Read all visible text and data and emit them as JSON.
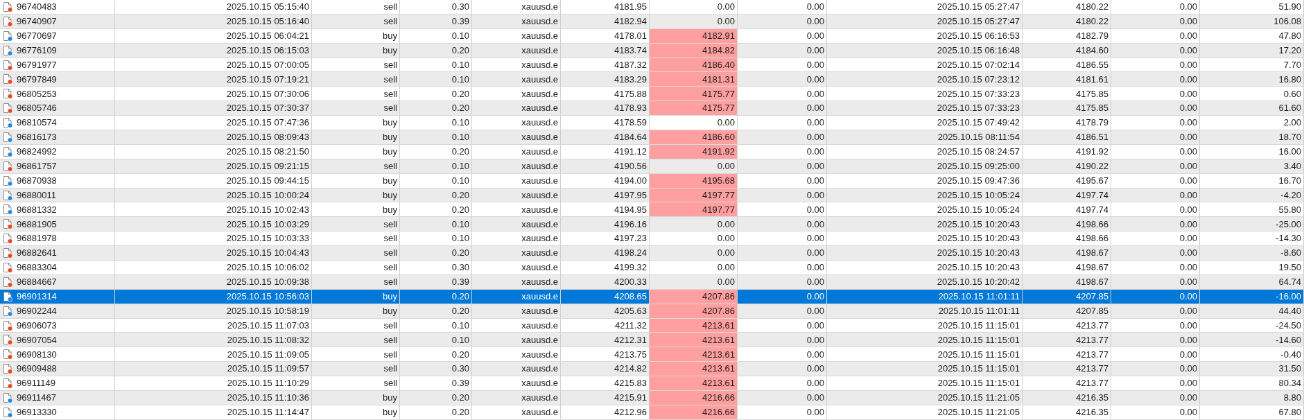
{
  "table": {
    "rows": [
      {
        "kind": "sell",
        "selected": false,
        "ticket": "96740483",
        "open_time": "2025.10.15 05:15:40",
        "type": "sell",
        "size": "0.30",
        "symbol": "xauusd.e",
        "open_price": "4181.95",
        "sl": "0.00",
        "sl_hit": false,
        "tp": "0.00",
        "close_time": "2025.10.15 05:27:47",
        "close_price": "4180.22",
        "swap": "0.00",
        "profit": "51.90"
      },
      {
        "kind": "sell",
        "selected": false,
        "ticket": "96740907",
        "open_time": "2025.10.15 05:16:40",
        "type": "sell",
        "size": "0.39",
        "symbol": "xauusd.e",
        "open_price": "4182.94",
        "sl": "0.00",
        "sl_hit": false,
        "tp": "0.00",
        "close_time": "2025.10.15 05:27:47",
        "close_price": "4180.22",
        "swap": "0.00",
        "profit": "106.08"
      },
      {
        "kind": "buy",
        "selected": false,
        "ticket": "96770697",
        "open_time": "2025.10.15 06:04:21",
        "type": "buy",
        "size": "0.10",
        "symbol": "xauusd.e",
        "open_price": "4178.01",
        "sl": "4182.91",
        "sl_hit": true,
        "tp": "0.00",
        "close_time": "2025.10.15 06:16:53",
        "close_price": "4182.79",
        "swap": "0.00",
        "profit": "47.80"
      },
      {
        "kind": "buy",
        "selected": false,
        "ticket": "96776109",
        "open_time": "2025.10.15 06:15:03",
        "type": "buy",
        "size": "0.20",
        "symbol": "xauusd.e",
        "open_price": "4183.74",
        "sl": "4184.82",
        "sl_hit": true,
        "tp": "0.00",
        "close_time": "2025.10.15 06:16:48",
        "close_price": "4184.60",
        "swap": "0.00",
        "profit": "17.20"
      },
      {
        "kind": "sell",
        "selected": false,
        "ticket": "96791977",
        "open_time": "2025.10.15 07:00:05",
        "type": "sell",
        "size": "0.10",
        "symbol": "xauusd.e",
        "open_price": "4187.32",
        "sl": "4186.40",
        "sl_hit": true,
        "tp": "0.00",
        "close_time": "2025.10.15 07:02:14",
        "close_price": "4186.55",
        "swap": "0.00",
        "profit": "7.70"
      },
      {
        "kind": "sell",
        "selected": false,
        "ticket": "96797849",
        "open_time": "2025.10.15 07:19:21",
        "type": "sell",
        "size": "0.10",
        "symbol": "xauusd.e",
        "open_price": "4183.29",
        "sl": "4181.31",
        "sl_hit": true,
        "tp": "0.00",
        "close_time": "2025.10.15 07:23:12",
        "close_price": "4181.61",
        "swap": "0.00",
        "profit": "16.80"
      },
      {
        "kind": "sell",
        "selected": false,
        "ticket": "96805253",
        "open_time": "2025.10.15 07:30:06",
        "type": "sell",
        "size": "0.20",
        "symbol": "xauusd.e",
        "open_price": "4175.88",
        "sl": "4175.77",
        "sl_hit": true,
        "tp": "0.00",
        "close_time": "2025.10.15 07:33:23",
        "close_price": "4175.85",
        "swap": "0.00",
        "profit": "0.60"
      },
      {
        "kind": "sell",
        "selected": false,
        "ticket": "96805746",
        "open_time": "2025.10.15 07:30:37",
        "type": "sell",
        "size": "0.20",
        "symbol": "xauusd.e",
        "open_price": "4178.93",
        "sl": "4175.77",
        "sl_hit": true,
        "tp": "0.00",
        "close_time": "2025.10.15 07:33:23",
        "close_price": "4175.85",
        "swap": "0.00",
        "profit": "61.60"
      },
      {
        "kind": "buy",
        "selected": false,
        "ticket": "96810574",
        "open_time": "2025.10.15 07:47:36",
        "type": "buy",
        "size": "0.10",
        "symbol": "xauusd.e",
        "open_price": "4178.59",
        "sl": "0.00",
        "sl_hit": false,
        "tp": "0.00",
        "close_time": "2025.10.15 07:49:42",
        "close_price": "4178.79",
        "swap": "0.00",
        "profit": "2.00"
      },
      {
        "kind": "buy",
        "selected": false,
        "ticket": "96816173",
        "open_time": "2025.10.15 08:09:43",
        "type": "buy",
        "size": "0.10",
        "symbol": "xauusd.e",
        "open_price": "4184.64",
        "sl": "4186.60",
        "sl_hit": true,
        "tp": "0.00",
        "close_time": "2025.10.15 08:11:54",
        "close_price": "4186.51",
        "swap": "0.00",
        "profit": "18.70"
      },
      {
        "kind": "buy",
        "selected": false,
        "ticket": "96824992",
        "open_time": "2025.10.15 08:21:50",
        "type": "buy",
        "size": "0.20",
        "symbol": "xauusd.e",
        "open_price": "4191.12",
        "sl": "4191.92",
        "sl_hit": true,
        "tp": "0.00",
        "close_time": "2025.10.15 08:24:57",
        "close_price": "4191.92",
        "swap": "0.00",
        "profit": "16.00"
      },
      {
        "kind": "sell",
        "selected": false,
        "ticket": "96861757",
        "open_time": "2025.10.15 09:21:15",
        "type": "sell",
        "size": "0.10",
        "symbol": "xauusd.e",
        "open_price": "4190.56",
        "sl": "0.00",
        "sl_hit": false,
        "tp": "0.00",
        "close_time": "2025.10.15 09:25:00",
        "close_price": "4190.22",
        "swap": "0.00",
        "profit": "3.40"
      },
      {
        "kind": "buy",
        "selected": false,
        "ticket": "96870938",
        "open_time": "2025.10.15 09:44:15",
        "type": "buy",
        "size": "0.10",
        "symbol": "xauusd.e",
        "open_price": "4194.00",
        "sl": "4195.68",
        "sl_hit": true,
        "tp": "0.00",
        "close_time": "2025.10.15 09:47:36",
        "close_price": "4195.67",
        "swap": "0.00",
        "profit": "16.70"
      },
      {
        "kind": "buy",
        "selected": false,
        "ticket": "96880011",
        "open_time": "2025.10.15 10:00:24",
        "type": "buy",
        "size": "0.20",
        "symbol": "xauusd.e",
        "open_price": "4197.95",
        "sl": "4197.77",
        "sl_hit": true,
        "tp": "0.00",
        "close_time": "2025.10.15 10:05:24",
        "close_price": "4197.74",
        "swap": "0.00",
        "profit": "-4.20"
      },
      {
        "kind": "buy",
        "selected": false,
        "ticket": "96881332",
        "open_time": "2025.10.15 10:02:43",
        "type": "buy",
        "size": "0.20",
        "symbol": "xauusd.e",
        "open_price": "4194.95",
        "sl": "4197.77",
        "sl_hit": true,
        "tp": "0.00",
        "close_time": "2025.10.15 10:05:24",
        "close_price": "4197.74",
        "swap": "0.00",
        "profit": "55.80"
      },
      {
        "kind": "sell",
        "selected": false,
        "ticket": "96881905",
        "open_time": "2025.10.15 10:03:29",
        "type": "sell",
        "size": "0.10",
        "symbol": "xauusd.e",
        "open_price": "4196.16",
        "sl": "0.00",
        "sl_hit": false,
        "tp": "0.00",
        "close_time": "2025.10.15 10:20:43",
        "close_price": "4198.66",
        "swap": "0.00",
        "profit": "-25.00"
      },
      {
        "kind": "sell",
        "selected": false,
        "ticket": "96881978",
        "open_time": "2025.10.15 10:03:33",
        "type": "sell",
        "size": "0.10",
        "symbol": "xauusd.e",
        "open_price": "4197.23",
        "sl": "0.00",
        "sl_hit": false,
        "tp": "0.00",
        "close_time": "2025.10.15 10:20:43",
        "close_price": "4198.66",
        "swap": "0.00",
        "profit": "-14.30"
      },
      {
        "kind": "sell",
        "selected": false,
        "ticket": "96882641",
        "open_time": "2025.10.15 10:04:43",
        "type": "sell",
        "size": "0.20",
        "symbol": "xauusd.e",
        "open_price": "4198.24",
        "sl": "0.00",
        "sl_hit": false,
        "tp": "0.00",
        "close_time": "2025.10.15 10:20:43",
        "close_price": "4198.67",
        "swap": "0.00",
        "profit": "-8.60"
      },
      {
        "kind": "sell",
        "selected": false,
        "ticket": "96883304",
        "open_time": "2025.10.15 10:06:02",
        "type": "sell",
        "size": "0.30",
        "symbol": "xauusd.e",
        "open_price": "4199.32",
        "sl": "0.00",
        "sl_hit": false,
        "tp": "0.00",
        "close_time": "2025.10.15 10:20:43",
        "close_price": "4198.67",
        "swap": "0.00",
        "profit": "19.50"
      },
      {
        "kind": "sell",
        "selected": false,
        "ticket": "96884667",
        "open_time": "2025.10.15 10:09:38",
        "type": "sell",
        "size": "0.39",
        "symbol": "xauusd.e",
        "open_price": "4200.33",
        "sl": "0.00",
        "sl_hit": false,
        "tp": "0.00",
        "close_time": "2025.10.15 10:20:42",
        "close_price": "4198.67",
        "swap": "0.00",
        "profit": "64.74"
      },
      {
        "kind": "buy",
        "selected": true,
        "ticket": "96901314",
        "open_time": "2025.10.15 10:56:03",
        "type": "buy",
        "size": "0.20",
        "symbol": "xauusd.e",
        "open_price": "4208.65",
        "sl": "4207.86",
        "sl_hit": true,
        "tp": "0.00",
        "close_time": "2025.10.15 11:01:11",
        "close_price": "4207.85",
        "swap": "0.00",
        "profit": "-16.00"
      },
      {
        "kind": "buy",
        "selected": false,
        "ticket": "96902244",
        "open_time": "2025.10.15 10:58:19",
        "type": "buy",
        "size": "0.20",
        "symbol": "xauusd.e",
        "open_price": "4205.63",
        "sl": "4207.86",
        "sl_hit": true,
        "tp": "0.00",
        "close_time": "2025.10.15 11:01:11",
        "close_price": "4207.85",
        "swap": "0.00",
        "profit": "44.40"
      },
      {
        "kind": "sell",
        "selected": false,
        "ticket": "96906073",
        "open_time": "2025.10.15 11:07:03",
        "type": "sell",
        "size": "0.10",
        "symbol": "xauusd.e",
        "open_price": "4211.32",
        "sl": "4213.61",
        "sl_hit": true,
        "tp": "0.00",
        "close_time": "2025.10.15 11:15:01",
        "close_price": "4213.77",
        "swap": "0.00",
        "profit": "-24.50"
      },
      {
        "kind": "sell",
        "selected": false,
        "ticket": "96907054",
        "open_time": "2025.10.15 11:08:32",
        "type": "sell",
        "size": "0.10",
        "symbol": "xauusd.e",
        "open_price": "4212.31",
        "sl": "4213.61",
        "sl_hit": true,
        "tp": "0.00",
        "close_time": "2025.10.15 11:15:01",
        "close_price": "4213.77",
        "swap": "0.00",
        "profit": "-14.60"
      },
      {
        "kind": "sell",
        "selected": false,
        "ticket": "96908130",
        "open_time": "2025.10.15 11:09:05",
        "type": "sell",
        "size": "0.20",
        "symbol": "xauusd.e",
        "open_price": "4213.75",
        "sl": "4213.61",
        "sl_hit": true,
        "tp": "0.00",
        "close_time": "2025.10.15 11:15:01",
        "close_price": "4213.77",
        "swap": "0.00",
        "profit": "-0.40"
      },
      {
        "kind": "sell",
        "selected": false,
        "ticket": "96909488",
        "open_time": "2025.10.15 11:09:57",
        "type": "sell",
        "size": "0.30",
        "symbol": "xauusd.e",
        "open_price": "4214.82",
        "sl": "4213.61",
        "sl_hit": true,
        "tp": "0.00",
        "close_time": "2025.10.15 11:15:01",
        "close_price": "4213.77",
        "swap": "0.00",
        "profit": "31.50"
      },
      {
        "kind": "sell",
        "selected": false,
        "ticket": "96911149",
        "open_time": "2025.10.15 11:10:29",
        "type": "sell",
        "size": "0.39",
        "symbol": "xauusd.e",
        "open_price": "4215.83",
        "sl": "4213.61",
        "sl_hit": true,
        "tp": "0.00",
        "close_time": "2025.10.15 11:15:01",
        "close_price": "4213.77",
        "swap": "0.00",
        "profit": "80.34"
      },
      {
        "kind": "buy",
        "selected": false,
        "ticket": "96911467",
        "open_time": "2025.10.15 11:10:36",
        "type": "buy",
        "size": "0.20",
        "symbol": "xauusd.e",
        "open_price": "4215.91",
        "sl": "4216.66",
        "sl_hit": true,
        "tp": "0.00",
        "close_time": "2025.10.15 11:21:05",
        "close_price": "4216.35",
        "swap": "0.00",
        "profit": "8.80"
      },
      {
        "kind": "buy",
        "selected": false,
        "ticket": "96913330",
        "open_time": "2025.10.15 11:14:47",
        "type": "buy",
        "size": "0.20",
        "symbol": "xauusd.e",
        "open_price": "4212.96",
        "sl": "4216.66",
        "sl_hit": true,
        "tp": "0.00",
        "close_time": "2025.10.15 11:21:05",
        "close_price": "4216.35",
        "swap": "0.00",
        "profit": "67.80"
      }
    ]
  }
}
